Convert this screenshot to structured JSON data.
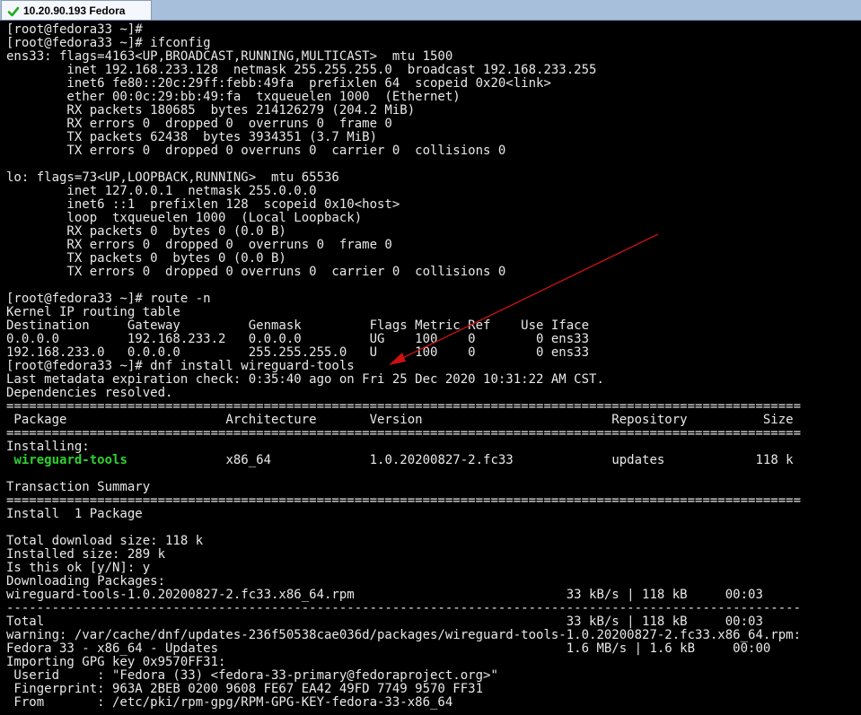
{
  "tab": {
    "title": "10.20.90.193 Fedora",
    "status_icon": "check-icon",
    "status_color": "#22aa22"
  },
  "colors": {
    "background": "#000000",
    "text": "#e8e8e8",
    "highlight_package": "#2fd12f",
    "annotation_arrow": "#cc1111"
  },
  "terminal": {
    "lines": [
      "[root@fedora33 ~]#",
      "[root@fedora33 ~]# ifconfig",
      "ens33: flags=4163<UP,BROADCAST,RUNNING,MULTICAST>  mtu 1500",
      "        inet 192.168.233.128  netmask 255.255.255.0  broadcast 192.168.233.255",
      "        inet6 fe80::20c:29ff:febb:49fa  prefixlen 64  scopeid 0x20<link>",
      "        ether 00:0c:29:bb:49:fa  txqueuelen 1000  (Ethernet)",
      "        RX packets 180685  bytes 214126279 (204.2 MiB)",
      "        RX errors 0  dropped 0  overruns 0  frame 0",
      "        TX packets 62438  bytes 3934351 (3.7 MiB)",
      "        TX errors 0  dropped 0 overruns 0  carrier 0  collisions 0",
      "",
      "lo: flags=73<UP,LOOPBACK,RUNNING>  mtu 65536",
      "        inet 127.0.0.1  netmask 255.0.0.0",
      "        inet6 ::1  prefixlen 128  scopeid 0x10<host>",
      "        loop  txqueuelen 1000  (Local Loopback)",
      "        RX packets 0  bytes 0 (0.0 B)",
      "        RX errors 0  dropped 0  overruns 0  frame 0",
      "        TX packets 0  bytes 0 (0.0 B)",
      "        TX errors 0  dropped 0 overruns 0  carrier 0  collisions 0",
      "",
      "[root@fedora33 ~]# route -n",
      "Kernel IP routing table",
      "Destination     Gateway         Genmask         Flags Metric Ref    Use Iface",
      "0.0.0.0         192.168.233.2   0.0.0.0         UG    100    0        0 ens33",
      "192.168.233.0   0.0.0.0         255.255.255.0   U     100    0        0 ens33",
      "[root@fedora33 ~]# dnf install wireguard-tools",
      "Last metadata expiration check: 0:35:40 ago on Fri 25 Dec 2020 10:31:22 AM CST.",
      "Dependencies resolved.",
      "=========================================================================================================",
      " Package                     Architecture       Version                         Repository          Size",
      "=========================================================================================================",
      "Installing:",
      {
        "segments": [
          {
            "text": " "
          },
          {
            "text": "wireguard-tools",
            "highlight": true
          },
          {
            "text": "             x86_64             1.0.20200827-2.fc33             updates            118 k"
          }
        ]
      },
      "",
      "Transaction Summary",
      "=========================================================================================================",
      "Install  1 Package",
      "",
      "Total download size: 118 k",
      "Installed size: 289 k",
      "Is this ok [y/N]: y",
      "Downloading Packages:",
      "wireguard-tools-1.0.20200827-2.fc33.x86_64.rpm                            33 kB/s | 118 kB     00:03",
      "---------------------------------------------------------------------------------------------------------",
      "Total                                                                     33 kB/s | 118 kB     00:03",
      "warning: /var/cache/dnf/updates-236f50538cae036d/packages/wireguard-tools-1.0.20200827-2.fc33.x86_64.rpm:",
      "Fedora 33 - x86_64 - Updates                                              1.6 MB/s | 1.6 kB     00:00",
      "Importing GPG key 0x9570FF31:",
      " Userid     : \"Fedora (33) <fedora-33-primary@fedoraproject.org>\"",
      " Fingerprint: 963A 2BEB 0200 9608 FE67 EA42 49FD 7749 9570 FF31",
      " From       : /etc/pki/rpm-gpg/RPM-GPG-KEY-fedora-33-x86_64"
    ]
  }
}
